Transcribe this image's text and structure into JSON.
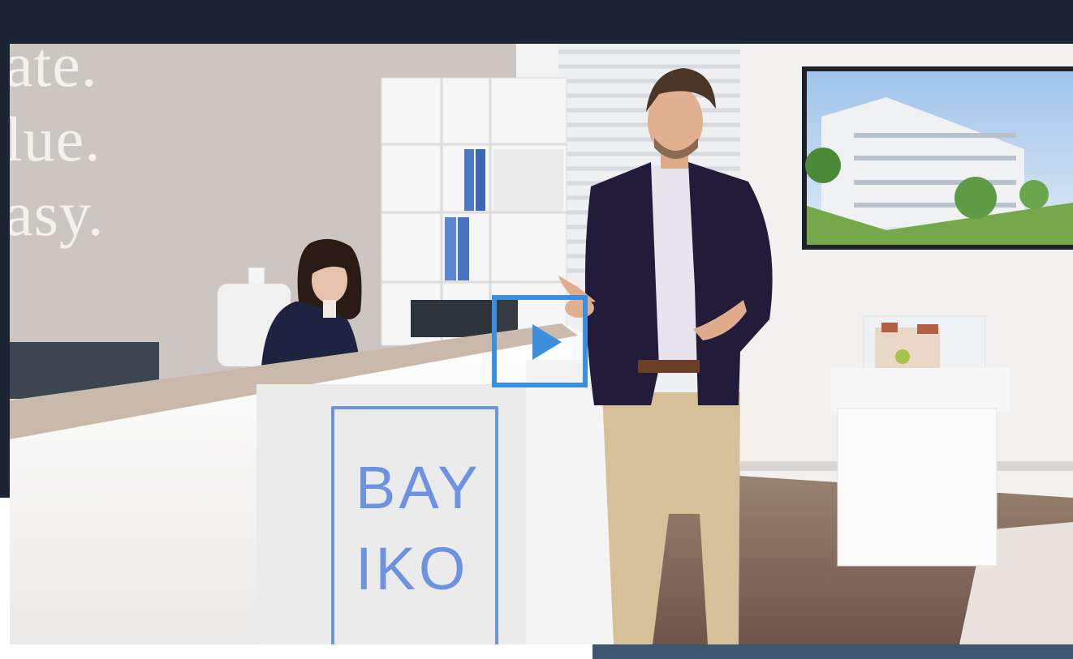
{
  "wall_text": {
    "line1": "ate.",
    "line2": "lue.",
    "line3": "asy."
  },
  "desk_logo": {
    "line1": "BAY",
    "line2": "IKO"
  },
  "player": {
    "play_icon": "play-triangle-icon",
    "accent_color": "#3b8fdc"
  },
  "colors": {
    "header_band": "#1b2534",
    "bottom_strip": "#3e5672",
    "logo_blue": "#6d93e0"
  }
}
